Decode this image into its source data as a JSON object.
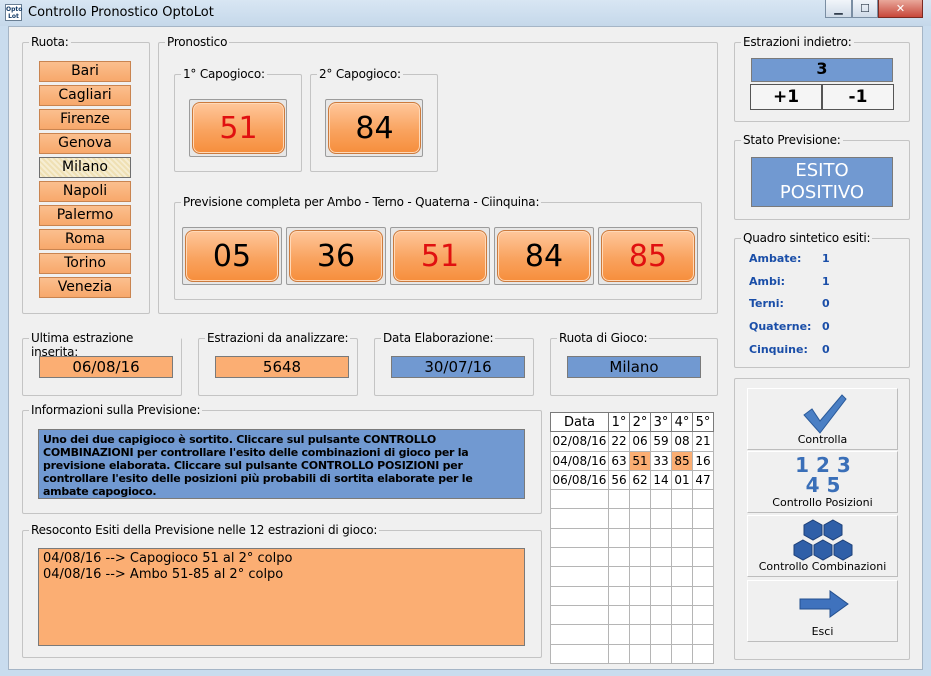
{
  "window": {
    "title": "Controllo Pronostico OptoLot",
    "app_icon_text": "Opto\nLot",
    "minimize_glyph": "▁",
    "maximize_glyph": "☐",
    "close_glyph": "✕"
  },
  "ruota": {
    "label": "Ruota:",
    "items": [
      "Bari",
      "Cagliari",
      "Firenze",
      "Genova",
      "Milano",
      "Napoli",
      "Palermo",
      "Roma",
      "Torino",
      "Venezia"
    ],
    "selected": "Milano"
  },
  "pronostico": {
    "label": "Pronostico",
    "capogioco1_label": "1° Capogioco:",
    "capogioco1": "51",
    "capogioco2_label": "2° Capogioco:",
    "capogioco2": "84",
    "previsione_label": "Previsione completa per Ambo - Terno - Quaterna - Ciinquina:",
    "numbers": [
      "05",
      "36",
      "51",
      "84",
      "85"
    ]
  },
  "estrazioni_indietro": {
    "label": "Estrazioni indietro:",
    "value": "3",
    "plus_label": "+1",
    "minus_label": "-1"
  },
  "stato_previsione": {
    "label": "Stato Previsione:",
    "line1": "ESITO",
    "line2": "POSITIVO"
  },
  "quadro": {
    "label": "Quadro sintetico esiti:",
    "rows": [
      {
        "label": "Ambate:",
        "value": "1"
      },
      {
        "label": "Ambi:",
        "value": "1"
      },
      {
        "label": "Terni:",
        "value": "0"
      },
      {
        "label": "Quaterne:",
        "value": "0"
      },
      {
        "label": "Cinquine:",
        "value": "0"
      }
    ]
  },
  "info_fields": {
    "ultima_label": "Ultima estrazione inserita:",
    "ultima_value": "06/08/16",
    "analizzare_label": "Estrazioni da analizzare:",
    "analizzare_value": "5648",
    "data_label": "Data Elaborazione:",
    "data_value": "30/07/16",
    "ruota_gioco_label": "Ruota di Gioco:",
    "ruota_gioco_value": "Milano"
  },
  "informazioni": {
    "label": "Informazioni sulla Previsione:",
    "text": "Uno dei due capigioco è sortito. Cliccare sul pulsante CONTROLLO COMBINAZIONI per controllare l'esito delle combinazioni di gioco per la previsione elaborata. Cliccare sul pulsante CONTROLLO POSIZIONI per controllare l'esito delle posizioni più probabili di sortita elaborate per le ambate capogioco."
  },
  "resoconto": {
    "label": "Resoconto Esiti della Previsione nelle 12 estrazioni di gioco:",
    "lines": [
      "04/08/16 --> Capogioco 51 al 2° colpo",
      "04/08/16 --> Ambo 51-85 al 2° colpo"
    ]
  },
  "estrazioni_table": {
    "headers": [
      "Data",
      "1°",
      "2°",
      "3°",
      "4°",
      "5°"
    ],
    "rows": [
      {
        "date": "02/08/16",
        "nums": [
          "22",
          "06",
          "59",
          "08",
          "21"
        ],
        "hl": [
          false,
          false,
          false,
          false,
          false
        ]
      },
      {
        "date": "04/08/16",
        "nums": [
          "63",
          "51",
          "33",
          "85",
          "16"
        ],
        "hl": [
          false,
          true,
          false,
          true,
          false
        ]
      },
      {
        "date": "06/08/16",
        "nums": [
          "56",
          "62",
          "14",
          "01",
          "47"
        ],
        "hl": [
          false,
          false,
          false,
          false,
          false
        ]
      }
    ],
    "empty_rows": 9
  },
  "actions": {
    "controlla": "Controlla",
    "controllo_posizioni": "Controllo Posizioni",
    "controllo_combinazioni": "Controllo Combinazioni",
    "esci": "Esci",
    "posizioni_icon_line1": "1 2 3",
    "posizioni_icon_line2": "4 5"
  },
  "colors": {
    "orange": "#fbae73",
    "blue": "#7199d1",
    "red_number": "#e01010",
    "stat_blue": "#1a4ea8"
  }
}
